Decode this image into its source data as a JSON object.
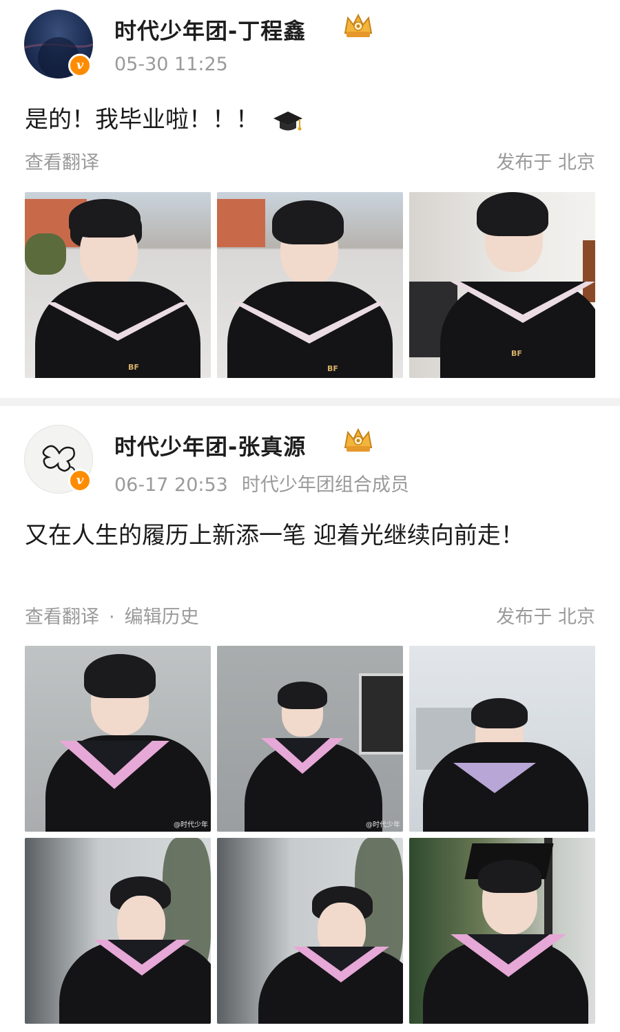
{
  "posts": [
    {
      "username": "时代少年团-丁程鑫",
      "timestamp": "05-30 11:25",
      "source": "",
      "text": "是的！我毕业啦！！！",
      "text_emoji": "graduation-cap-emoji",
      "translate_label": "查看翻译",
      "edit_history_label": "",
      "location_label": "发布于 北京",
      "badge_icon": "verified-badge-icon",
      "member_icon": "crown-membership-icon",
      "photo_count": 3
    },
    {
      "username": "时代少年团-张真源",
      "timestamp": "06-17 20:53",
      "source": "时代少年团组合成员",
      "text": "又在人生的履历上新添一笔 迎着光继续向前走！",
      "translate_label": "查看翻译",
      "separator": "·",
      "edit_history_label": "编辑历史",
      "location_label": "发布于 北京",
      "badge_icon": "verified-badge-icon",
      "member_icon": "crown-membership-icon",
      "photo_count": 6,
      "watermark": "@时代少年"
    }
  ],
  "logos": {
    "bf": "BF"
  },
  "colors": {
    "verified_orange": "#ff8c00",
    "meta_gray": "#9a9a9a",
    "gown_black": "#141416",
    "collar_pink": "#e6a8d6"
  }
}
